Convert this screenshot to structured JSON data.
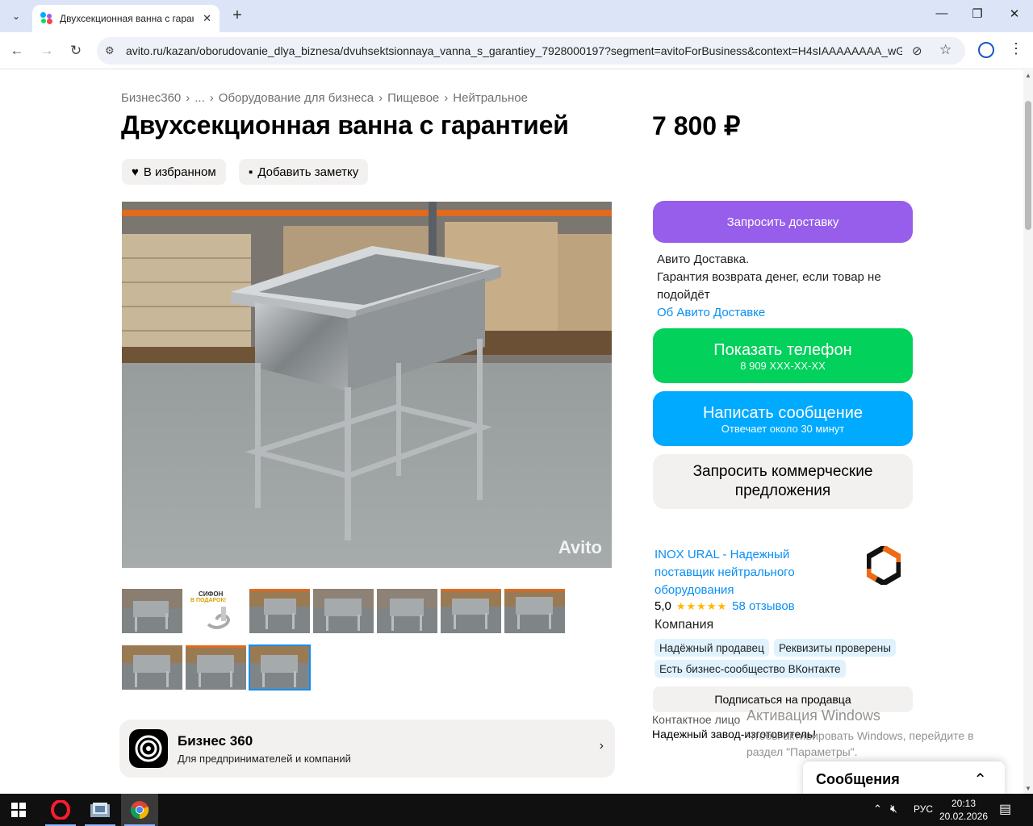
{
  "browser": {
    "tab_title": "Двухсекционная ванна с гарантией",
    "url": "avito.ru/kazan/oborudovanie_dlya_biznesa/dvuhsektsionnaya_vanna_s_garantiey_7928000197?segment=avitoForBusiness&context=H4sIAAAAAAAA_wGU...",
    "new_tab": "+",
    "close_tab": "✕",
    "minimize": "—",
    "restore": "❐",
    "close": "✕"
  },
  "breadcrumb": {
    "items": [
      "Бизнес360",
      "...",
      "Оборудование для бизнеса",
      "Пищевое",
      "Нейтральное"
    ],
    "sep": "›"
  },
  "listing": {
    "title": "Двухсекционная ванна с гарантией",
    "price": "7 800 ₽",
    "fav_label": "В избранном",
    "note_label": "Добавить заметку",
    "watermark": "Avito",
    "thumb2_text_top": "СИФОН",
    "thumb2_text_bottom": "В ПОДАРОК!"
  },
  "delivery": {
    "button": "Запросить доставку",
    "line1": "Авито Доставка.",
    "line2": "Гарантия возврата денег, если товар не подойдёт",
    "link": "Об Авито Доставке"
  },
  "actions": {
    "phone_main": "Показать телефон",
    "phone_sub": "8 909 XXX-XX-XX",
    "msg_main": "Написать сообщение",
    "msg_sub": "Отвечает около 30 минут",
    "offers": "Запросить коммерческие предложения"
  },
  "seller": {
    "name": "INOX URAL - Надежный поставщик нейтрального оборудования",
    "rating": "5,0",
    "stars": "★★★★★",
    "reviews": "58 отзывов",
    "type": "Компания",
    "badges": [
      "Надёжный продавец",
      "Реквизиты проверены",
      "Есть бизнес-сообщество ВКонтакте"
    ],
    "subscribe": "Подписаться на продавца",
    "contact_label": "Контактное лицо",
    "contact_text": "Надежный завод-изготовитель!"
  },
  "biz_banner": {
    "title": "Бизнес 360",
    "subtitle": "Для предпринимателей и компаний"
  },
  "windows": {
    "activate_title": "Активация Windows",
    "activate_text": "Чтобы активировать Windows, перейдите в раздел \"Параметры\".",
    "lang": "РУС",
    "time": "20:13",
    "date": "20.02.2026"
  },
  "messages": {
    "title": "Сообщения"
  },
  "colors": {
    "delivery": "#965eeb",
    "phone": "#02d15c",
    "message": "#00aaff",
    "link": "#0a8ff5"
  }
}
